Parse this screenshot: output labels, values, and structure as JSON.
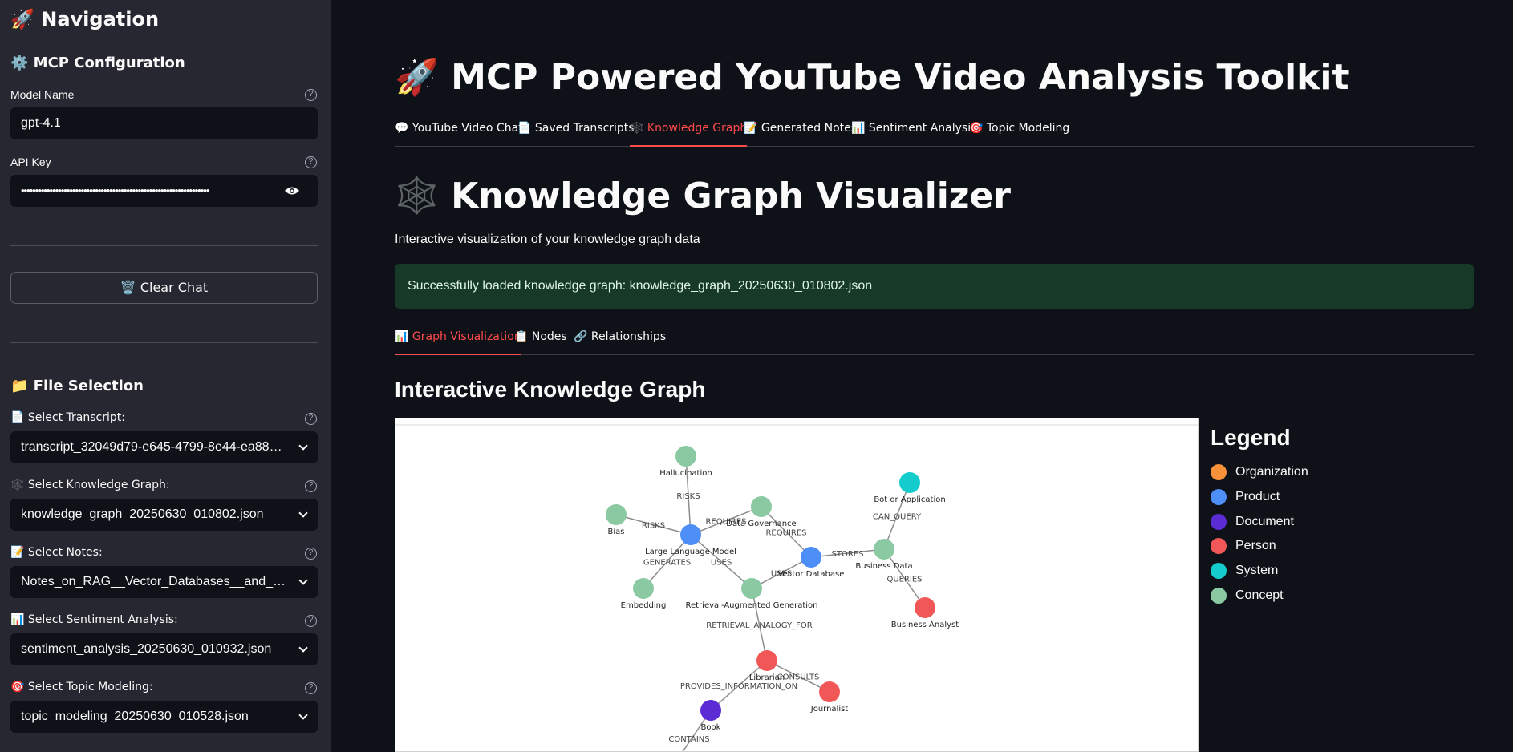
{
  "sidebar": {
    "title": "🚀 Navigation",
    "config_heading": "⚙️ MCP Configuration",
    "model_label": "Model Name",
    "model_value": "gpt-4.1",
    "api_label": "API Key",
    "api_value": "••••••••••••••••••••••••••••••••••••••••••••••••••••••••••••••••••",
    "clear_button": "🗑️ Clear Chat",
    "file_heading": "📁 File Selection",
    "transcript_label": "📄 Select Transcript:",
    "transcript_value": "transcript_32049d79-e645-4799-8e44-ea88158...",
    "kg_label": "🕸️ Select Knowledge Graph:",
    "kg_value": "knowledge_graph_20250630_010802.json",
    "notes_label": "📝 Select Notes:",
    "notes_value": "Notes_on_RAG__Vector_Databases__and_LL...",
    "sentiment_label": "📊 Select Sentiment Analysis:",
    "sentiment_value": "sentiment_analysis_20250630_010932.json",
    "topic_label": "🎯 Select Topic Modeling:",
    "topic_value": "topic_modeling_20250630_010528.json"
  },
  "main": {
    "title": "🚀 MCP Powered YouTube Video Analysis Toolkit",
    "tabs": [
      {
        "label": "💬 YouTube Video Chat"
      },
      {
        "label": "📄 Saved Transcripts"
      },
      {
        "label": "🕸️ Knowledge Graph"
      },
      {
        "label": "📝 Generated Notes"
      },
      {
        "label": "📊 Sentiment Analysis"
      },
      {
        "label": "🎯 Topic Modeling"
      }
    ],
    "page_heading": "🕸️ Knowledge Graph Visualizer",
    "subtitle": "Interactive visualization of your knowledge graph data",
    "success_message": "Successfully loaded knowledge graph: knowledge_graph_20250630_010802.json",
    "sub_tabs": [
      {
        "label": "📊 Graph Visualization"
      },
      {
        "label": "📋 Nodes"
      },
      {
        "label": "🔗 Relationships"
      }
    ],
    "graph_heading": "Interactive Knowledge Graph"
  },
  "legend": {
    "title": "Legend",
    "items": [
      {
        "label": "Organization",
        "color": "#f7923b"
      },
      {
        "label": "Product",
        "color": "#4e8ef7"
      },
      {
        "label": "Document",
        "color": "#5b2bd4"
      },
      {
        "label": "Person",
        "color": "#f25757"
      },
      {
        "label": "System",
        "color": "#14cccc"
      },
      {
        "label": "Concept",
        "color": "#8ac9a2"
      }
    ]
  },
  "graph": {
    "colors": {
      "Product": "#4e8ef7",
      "Concept": "#8ac9a2",
      "Person": "#f25757",
      "Document": "#5b2bd4",
      "System": "#14cccc"
    },
    "nodes": [
      {
        "id": "llm",
        "label": "Large Language Model",
        "type": "Product"
      },
      {
        "id": "hallucination",
        "label": "Hallucination",
        "type": "Concept"
      },
      {
        "id": "bias",
        "label": "Bias",
        "type": "Concept"
      },
      {
        "id": "datagov",
        "label": "Data Governance",
        "type": "Concept"
      },
      {
        "id": "embedding",
        "label": "Embedding",
        "type": "Concept"
      },
      {
        "id": "rag",
        "label": "Retrieval-Augmented Generation",
        "type": "Concept"
      },
      {
        "id": "vectordb",
        "label": "Vector Database",
        "type": "Product"
      },
      {
        "id": "businessdata",
        "label": "Business Data",
        "type": "Concept"
      },
      {
        "id": "bot",
        "label": "Bot or Application",
        "type": "System"
      },
      {
        "id": "analyst",
        "label": "Business Analyst",
        "type": "Person"
      },
      {
        "id": "librarian",
        "label": "Librarian",
        "type": "Person"
      },
      {
        "id": "journalist",
        "label": "Journalist",
        "type": "Person"
      },
      {
        "id": "book",
        "label": "Book",
        "type": "Document"
      }
    ],
    "edges": [
      {
        "from": "llm",
        "to": "hallucination",
        "label": "RISKS"
      },
      {
        "from": "llm",
        "to": "bias",
        "label": "RISKS"
      },
      {
        "from": "llm",
        "to": "datagov",
        "label": "REQUIRES"
      },
      {
        "from": "vectordb",
        "to": "datagov",
        "label": "REQUIRES"
      },
      {
        "from": "llm",
        "to": "embedding",
        "label": "GENERATES"
      },
      {
        "from": "llm",
        "to": "rag",
        "label": "USES"
      },
      {
        "from": "rag",
        "to": "vectordb",
        "label": "USES"
      },
      {
        "from": "vectordb",
        "to": "businessdata",
        "label": "STORES"
      },
      {
        "from": "bot",
        "to": "businessdata",
        "label": "CAN_QUERY"
      },
      {
        "from": "analyst",
        "to": "businessdata",
        "label": "QUERIES"
      },
      {
        "from": "librarian",
        "to": "rag",
        "label": "RETRIEVAL_ANALOGY_FOR"
      },
      {
        "from": "journalist",
        "to": "librarian",
        "label": "CONSULTS"
      },
      {
        "from": "book",
        "to": "librarian",
        "label": "PROVIDES_INFORMATION_ON"
      },
      {
        "from": "book",
        "to": "",
        "label": "CONTAINS"
      }
    ]
  }
}
